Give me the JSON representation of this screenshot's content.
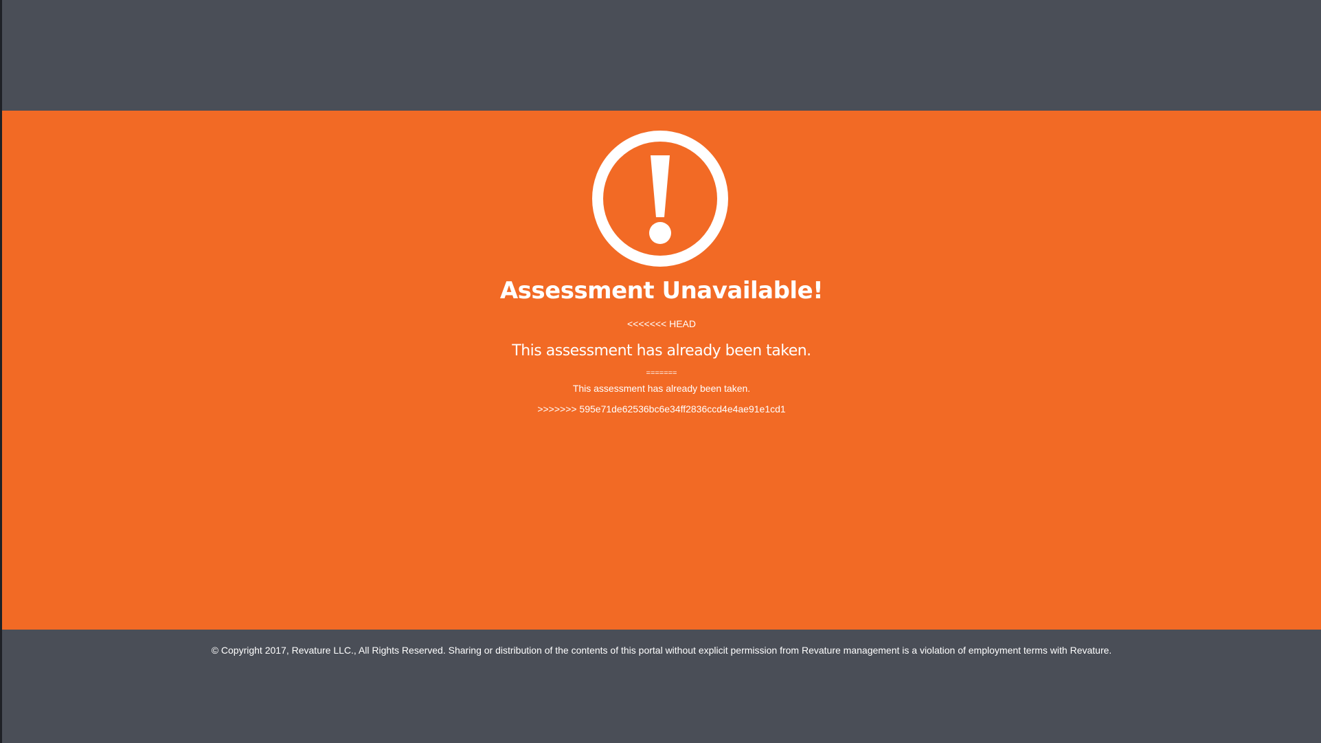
{
  "notice": {
    "icon": "exclamation-circle-icon",
    "title": "Assessment Unavailable!",
    "conflict_head": "<<<<<<< HEAD",
    "message_large": "This assessment has already been taken.",
    "conflict_separator": "=======",
    "message_small": "This assessment has already been taken.",
    "conflict_tail": ">>>>>>> 595e71de62536bc6e34ff2836ccd4e4ae91e1cd1"
  },
  "footer": {
    "copyright": "© Copyright 2017, Revature LLC., All Rights Reserved. Sharing or distribution of the contents of this portal without explicit permission from Revature management is a violation of employment terms with Revature."
  },
  "colors": {
    "accent": "#f26a25",
    "chrome": "#4a4e57",
    "text": "#ffffff"
  }
}
